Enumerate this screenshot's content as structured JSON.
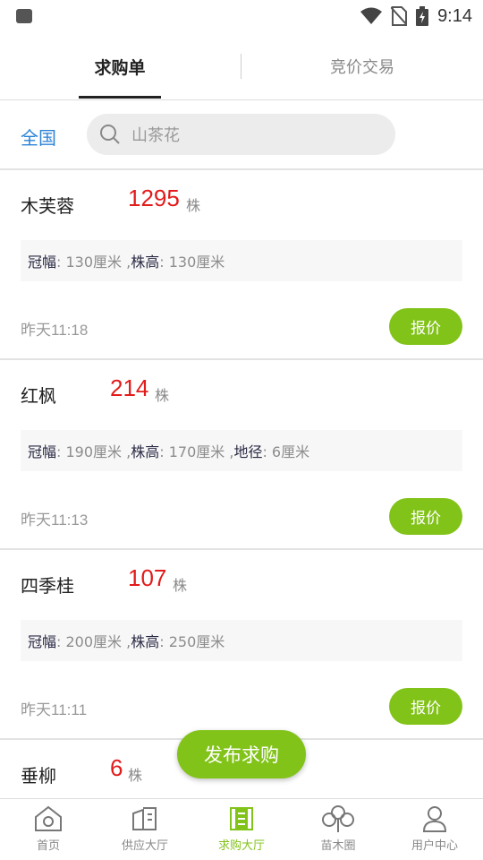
{
  "status_bar": {
    "time": "9:14"
  },
  "tabs": [
    {
      "label": "求购单"
    },
    {
      "label": "竞价交易"
    }
  ],
  "search": {
    "region": "全国",
    "placeholder": "山茶花"
  },
  "listings": [
    {
      "name": "木芙蓉",
      "qty": "1295",
      "unit": "株",
      "specs": [
        {
          "k": "冠幅",
          "v": ": 130厘米 ,"
        },
        {
          "k": "株高",
          "v": ": 130厘米"
        }
      ],
      "time": "昨天11:18",
      "quote_label": "报价"
    },
    {
      "name": "红枫",
      "qty": "214",
      "unit": "株",
      "specs": [
        {
          "k": "冠幅",
          "v": ": 190厘米 ,"
        },
        {
          "k": "株高",
          "v": ": 170厘米 ,"
        },
        {
          "k": "地径",
          "v": ": 6厘米"
        }
      ],
      "time": "昨天11:13",
      "quote_label": "报价"
    },
    {
      "name": "四季桂",
      "qty": "107",
      "unit": "株",
      "specs": [
        {
          "k": "冠幅",
          "v": ": 200厘米 ,"
        },
        {
          "k": "株高",
          "v": ": 250厘米"
        }
      ],
      "time": "昨天11:11",
      "quote_label": "报价"
    },
    {
      "name": "垂柳",
      "qty": "6",
      "unit": "株"
    }
  ],
  "publish_label": "发布求购",
  "nav": [
    {
      "label": "首页",
      "icon": "home-icon"
    },
    {
      "label": "供应大厅",
      "icon": "supply-icon"
    },
    {
      "label": "求购大厅",
      "icon": "purchase-icon"
    },
    {
      "label": "苗木圈",
      "icon": "tree-icon"
    },
    {
      "label": "用户中心",
      "icon": "user-icon"
    }
  ],
  "colors": {
    "accent_green": "#82c31a",
    "qty_red": "#e21b1b",
    "region_blue": "#2d83d6"
  }
}
